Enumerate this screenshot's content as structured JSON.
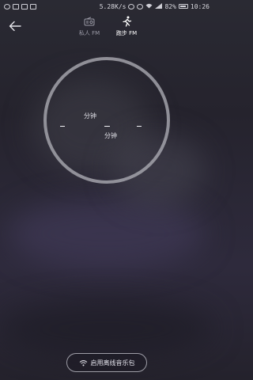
{
  "status_bar": {
    "net_speed": "5.28K/s",
    "battery": "82%",
    "time": "10:26"
  },
  "header": {
    "tabs": [
      {
        "label": "私人 FM",
        "icon": "radio-icon",
        "selected": false
      },
      {
        "label": "跑步 FM",
        "icon": "running-icon",
        "selected": true
      }
    ]
  },
  "ring": {
    "label_top": "分钟",
    "label_bottom": "分钟"
  },
  "offline_button": {
    "label": "启用离线音乐包",
    "icon": "wifi-icon"
  }
}
